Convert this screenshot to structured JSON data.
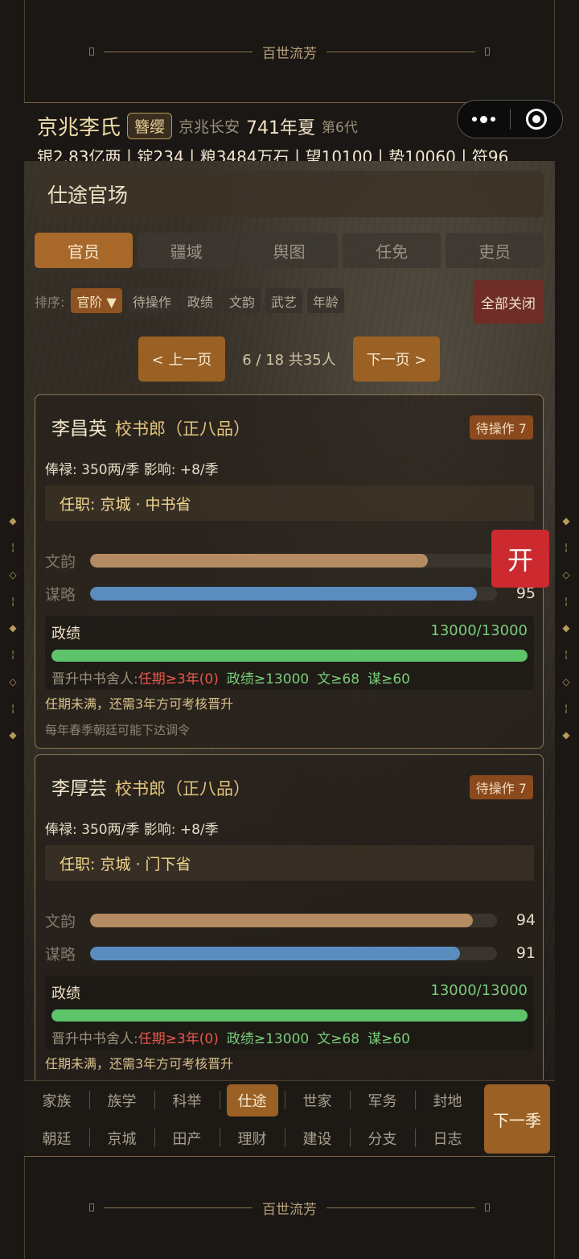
{
  "banner": {
    "title": "百世流芳"
  },
  "header": {
    "clan": "京兆李氏",
    "rank_badge": "簪缨",
    "location": "京兆长安",
    "year": "741年夏",
    "generation": "第6代",
    "resources": "银2.83亿两丨锭234丨粮3484万石丨望10100丨势10060丨符96"
  },
  "page": {
    "title": "仕途官场",
    "tabs": [
      {
        "label": "官员",
        "active": true
      },
      {
        "label": "疆域",
        "active": false
      },
      {
        "label": "舆图",
        "active": false
      },
      {
        "label": "任免",
        "active": false
      },
      {
        "label": "吏员",
        "active": false
      }
    ],
    "sort": {
      "label": "排序:",
      "options": [
        "官阶 ▼",
        "待操作",
        "政绩",
        "文韵",
        "武艺",
        "年龄"
      ],
      "active_index": 0,
      "close_all": "全部关闭"
    },
    "pager": {
      "prev": "< 上一页",
      "info": "6 / 18  共35人",
      "next": "下一页 >"
    }
  },
  "officials": [
    {
      "name": "李昌英",
      "title": "校书郎（正八品）",
      "pending": "待操作 7",
      "pay": "俸禄: 350两/季   影响: +8/季",
      "post": "任职: 京城 · 中书省",
      "wenyun_label": "文韵",
      "wenyun": 83,
      "wenyun_text": "",
      "moulue_label": "谋略",
      "moulue": 95,
      "moulue_text": "95",
      "perf_label": "政绩",
      "perf_value": "13000/13000",
      "perf_fraction": 1.0,
      "promo_label": "晋升中书舍人:",
      "req_term": "任期≥3年(0)",
      "req_perf": "政绩≥13000",
      "req_wen": "文≥68",
      "req_mou": "谋≥60",
      "note1": "任期未满，还需3年方可考核晋升",
      "note2": "每年春季朝廷可能下达调令"
    },
    {
      "name": "李厚芸",
      "title": "校书郎（正八品）",
      "pending": "待操作 7",
      "pay": "俸禄: 350两/季   影响: +8/季",
      "post": "任职: 京城 · 门下省",
      "wenyun_label": "文韵",
      "wenyun": 94,
      "wenyun_text": "94",
      "moulue_label": "谋略",
      "moulue": 91,
      "moulue_text": "91",
      "perf_label": "政绩",
      "perf_value": "13000/13000",
      "perf_fraction": 1.0,
      "promo_label": "晋升中书舍人:",
      "req_term": "任期≥3年(0)",
      "req_perf": "政绩≥13000",
      "req_wen": "文≥68",
      "req_mou": "谋≥60",
      "note1": "任期未满，还需3年方可考核晋升",
      "note2": ""
    }
  ],
  "float_button": "开",
  "bottom_nav": {
    "row1": [
      "家族",
      "族学",
      "科举",
      "仕途",
      "世家",
      "军务",
      "封地"
    ],
    "row2": [
      "朝廷",
      "京城",
      "田产",
      "理财",
      "建设",
      "分支",
      "日志"
    ],
    "active": "仕途",
    "next_season": "下一季"
  },
  "colors": {
    "accent": "#9a6024",
    "wenyun_bar": "#b58b62",
    "moulue_bar": "#5b8cc0",
    "perf_bar": "#5ec46a",
    "fail": "#e8574a",
    "pass": "#79cc79"
  }
}
